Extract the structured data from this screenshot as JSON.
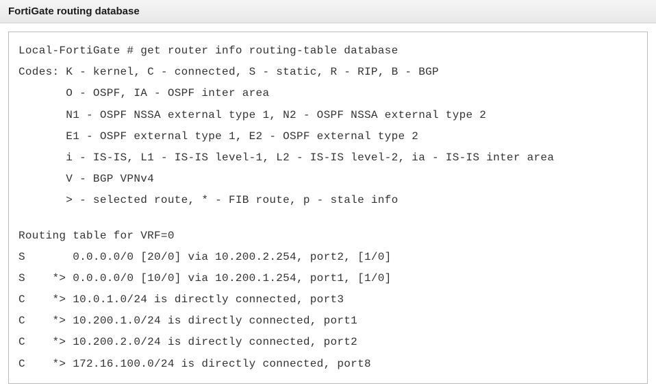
{
  "header": {
    "title": "FortiGate routing database"
  },
  "terminal": {
    "line0": "Local-FortiGate # get router info routing-table database",
    "line1": "Codes: K - kernel, C - connected, S - static, R - RIP, B - BGP",
    "line2": "       O - OSPF, IA - OSPF inter area",
    "line3": "       N1 - OSPF NSSA external type 1, N2 - OSPF NSSA external type 2",
    "line4": "       E1 - OSPF external type 1, E2 - OSPF external type 2",
    "line5": "       i - IS-IS, L1 - IS-IS level-1, L2 - IS-IS level-2, ia - IS-IS inter area",
    "line6": "       V - BGP VPNv4",
    "line7": "       > - selected route, * - FIB route, p - stale info",
    "line8": "Routing table for VRF=0",
    "line9": "S       0.0.0.0/0 [20/0] via 10.200.2.254, port2, [1/0]",
    "line10": "S    *> 0.0.0.0/0 [10/0] via 10.200.1.254, port1, [1/0]",
    "line11": "C    *> 10.0.1.0/24 is directly connected, port3",
    "line12": "C    *> 10.200.1.0/24 is directly connected, port1",
    "line13": "C    *> 10.200.2.0/24 is directly connected, port2",
    "line14": "C    *> 172.16.100.0/24 is directly connected, port8"
  }
}
